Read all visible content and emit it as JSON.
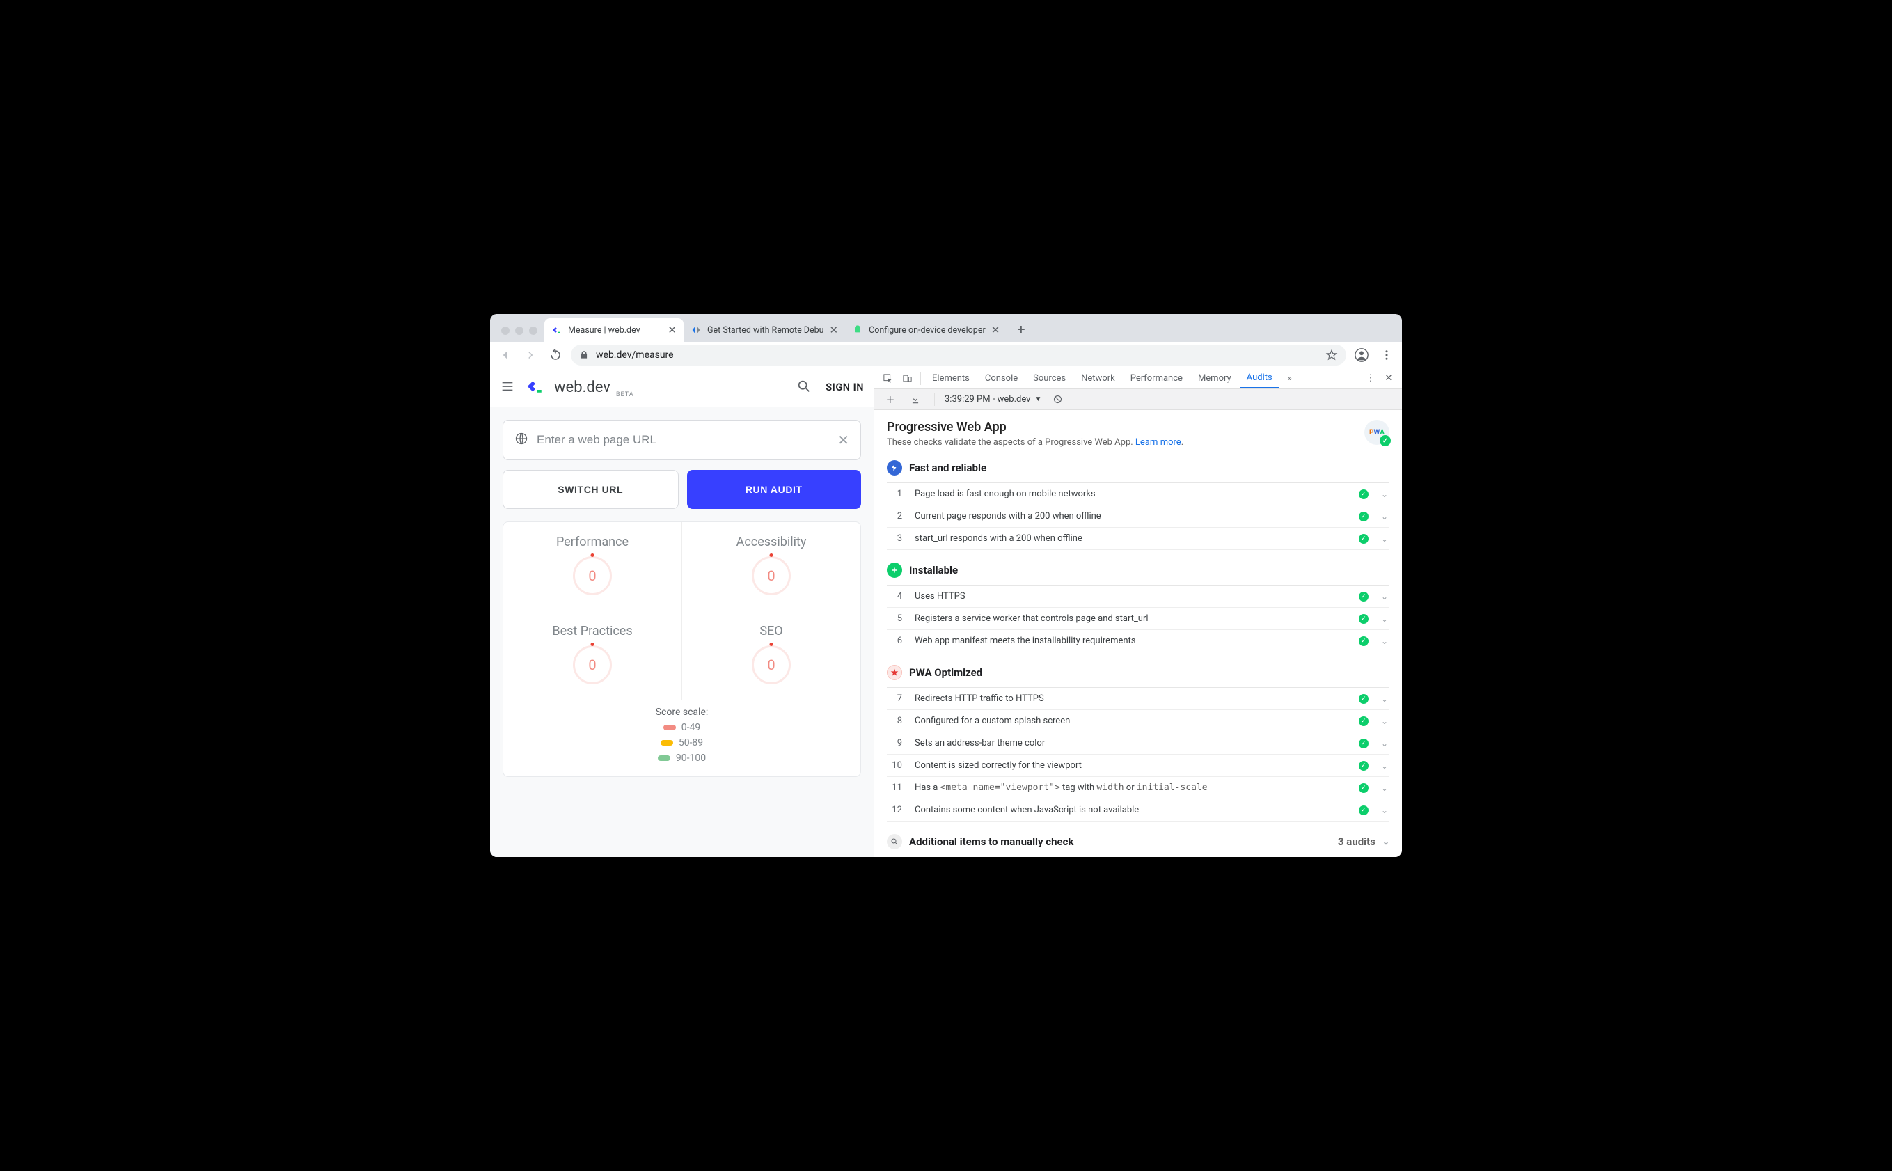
{
  "browser": {
    "tabs": [
      {
        "title": "Measure  |  web.dev",
        "active": true
      },
      {
        "title": "Get Started with Remote Debu",
        "active": false
      },
      {
        "title": "Configure on-device developer",
        "active": false
      }
    ],
    "url": "web.dev/measure"
  },
  "page": {
    "logo_text": "web.dev",
    "logo_beta": "BETA",
    "signin": "SIGN IN",
    "url_placeholder": "Enter a web page URL",
    "switch_btn": "SWITCH URL",
    "run_btn": "RUN AUDIT",
    "scores": {
      "perf": {
        "label": "Performance",
        "value": "0"
      },
      "a11y": {
        "label": "Accessibility",
        "value": "0"
      },
      "bp": {
        "label": "Best Practices",
        "value": "0"
      },
      "seo": {
        "label": "SEO",
        "value": "0"
      }
    },
    "scale": {
      "title": "Score scale:",
      "r1": "0-49",
      "r2": "50-89",
      "r3": "90-100"
    }
  },
  "devtools": {
    "tabs": [
      "Elements",
      "Console",
      "Sources",
      "Network",
      "Performance",
      "Memory",
      "Audits"
    ],
    "active_tab": "Audits",
    "run_selector": "3:39:29 PM - web.dev",
    "pwa": {
      "title": "Progressive Web App",
      "desc_a": "These checks validate the aspects of a Progressive Web App. ",
      "desc_link": "Learn more",
      "badge": "PWA",
      "sections": [
        {
          "icon": "fast",
          "title": "Fast and reliable",
          "items": [
            {
              "n": "1",
              "text": "Page load is fast enough on mobile networks"
            },
            {
              "n": "2",
              "text": "Current page responds with a 200 when offline"
            },
            {
              "n": "3",
              "text": "start_url responds with a 200 when offline"
            }
          ]
        },
        {
          "icon": "inst",
          "title": "Installable",
          "items": [
            {
              "n": "4",
              "text": "Uses HTTPS"
            },
            {
              "n": "5",
              "text": "Registers a service worker that controls page and start_url"
            },
            {
              "n": "6",
              "text": "Web app manifest meets the installability requirements"
            }
          ]
        },
        {
          "icon": "opt",
          "title": "PWA Optimized",
          "items": [
            {
              "n": "7",
              "text": "Redirects HTTP traffic to HTTPS"
            },
            {
              "n": "8",
              "text": "Configured for a custom splash screen"
            },
            {
              "n": "9",
              "text": "Sets an address-bar theme color"
            },
            {
              "n": "10",
              "text": "Content is sized correctly for the viewport"
            },
            {
              "n": "11",
              "html": "Has a <code>&lt;meta name=\"viewport\"&gt;</code> tag with <code>width</code> or <code>initial-scale</code>"
            },
            {
              "n": "12",
              "text": "Contains some content when JavaScript is not available"
            }
          ]
        }
      ],
      "manual": {
        "title": "Additional items to manually check",
        "count": "3 audits"
      }
    }
  }
}
